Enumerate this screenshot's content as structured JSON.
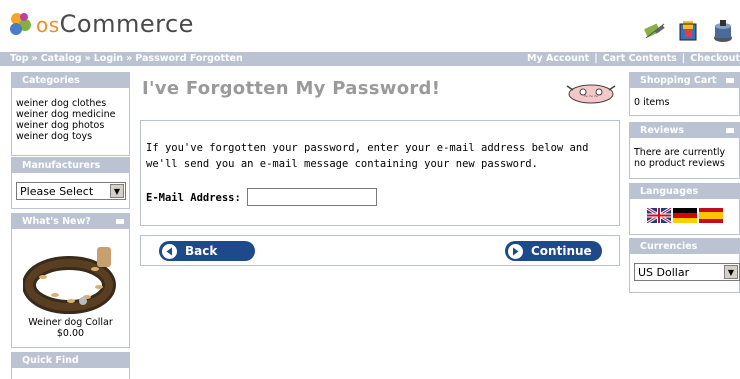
{
  "header": {
    "logo_prefix": "os",
    "logo_text": "Commerce",
    "icons": [
      "my-account-icon",
      "cart-icon",
      "checkout-icon"
    ]
  },
  "breadcrumb": {
    "items": [
      "Top",
      "Catalog",
      "Login",
      "Password Forgotten"
    ],
    "separator": "»"
  },
  "toplinks": {
    "my_account": "My Account",
    "divider": "|",
    "cart_contents": "Cart Contents",
    "checkout": "Checkout"
  },
  "categories": {
    "title": "Categories",
    "items": [
      "weiner dog clothes",
      "weiner dog medicine",
      "weiner dog photos",
      "weiner dog toys"
    ]
  },
  "manufacturers": {
    "title": "Manufacturers",
    "selected": "Please Select"
  },
  "whats_new": {
    "title": "What's New?",
    "product_name": "Weiner dog Collar",
    "price": "$0.00"
  },
  "quick_find": {
    "title": "Quick Find"
  },
  "shopping_cart": {
    "title": "Shopping Cart",
    "content": "0 items"
  },
  "reviews": {
    "title": "Reviews",
    "content": "There are currently no product reviews"
  },
  "languages": {
    "title": "Languages",
    "flags": [
      "English",
      "Deutsch",
      "Español"
    ]
  },
  "currencies": {
    "title": "Currencies",
    "selected": "US Dollar"
  },
  "main": {
    "title": "I've Forgotten My Password!",
    "instructions": "If you've forgotten your password, enter your e-mail address below and we'll send you an e-mail message containing your new password.",
    "email_label": "E-Mail Address:",
    "email_value": "",
    "back_label": "Back",
    "continue_label": "Continue"
  },
  "colors": {
    "box_header": "#bbc3d3",
    "button": "#1e4a8c",
    "title": "#9a9a9a"
  }
}
